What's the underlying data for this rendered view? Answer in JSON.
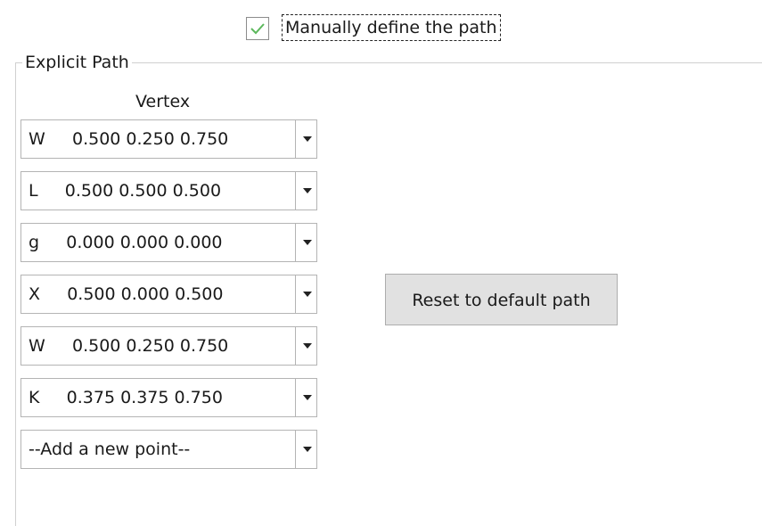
{
  "checkbox": {
    "label": "Manually define the path",
    "checked": true,
    "check_color": "#5cb85c"
  },
  "explicit_path": {
    "title": "Explicit Path",
    "column_header": "Vertex",
    "rows": [
      {
        "text": "W     0.500 0.250 0.750"
      },
      {
        "text": "L     0.500 0.500 0.500"
      },
      {
        "text": "g     0.000 0.000 0.000"
      },
      {
        "text": "X     0.500 0.000 0.500"
      },
      {
        "text": "W     0.500 0.250 0.750"
      },
      {
        "text": "K     0.375 0.375 0.750"
      },
      {
        "text": "--Add a new point--"
      }
    ]
  },
  "reset_button_label": "Reset to default path"
}
